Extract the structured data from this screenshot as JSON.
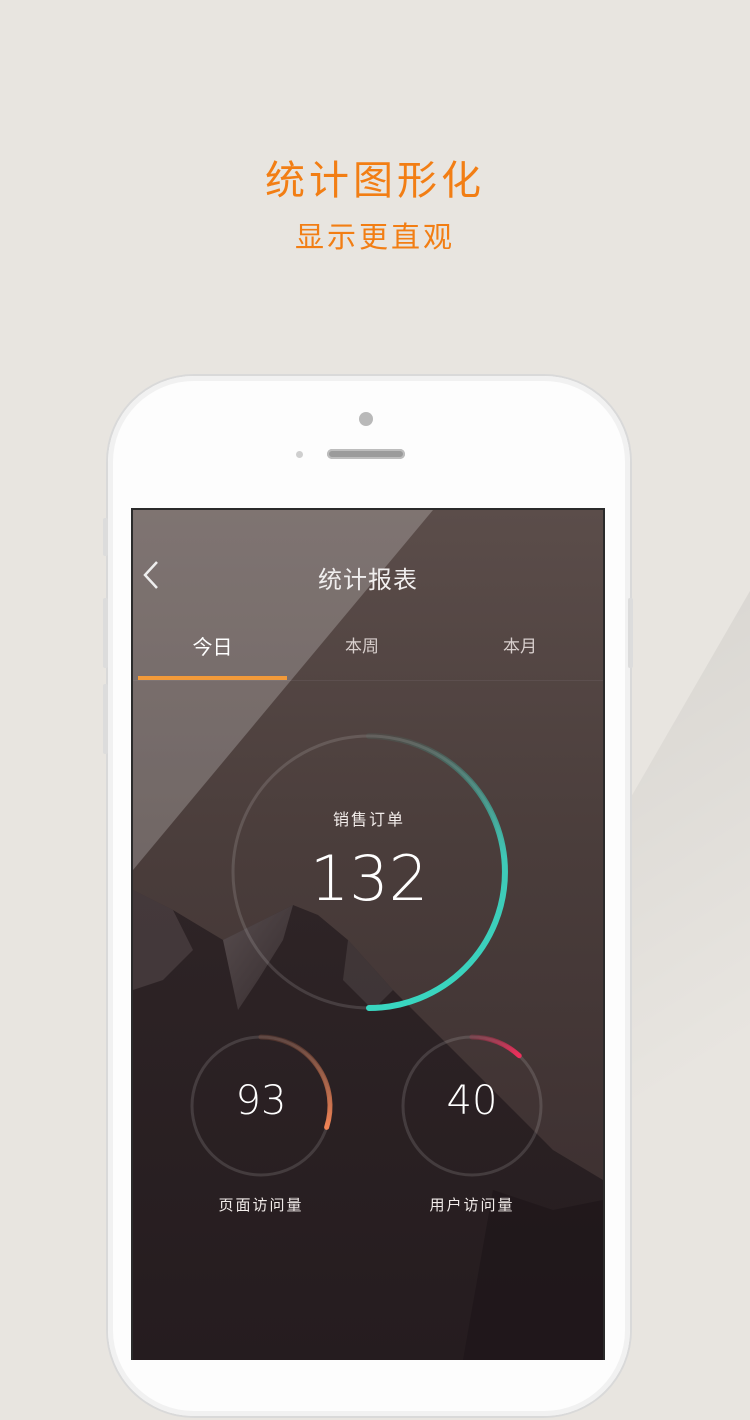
{
  "promo": {
    "title": "统计图形化",
    "subtitle": "显示更直观"
  },
  "colors": {
    "accent": "#f27e14",
    "tab_underline": "#f29a3a",
    "ring_teal": "#39d6c0",
    "ring_orange": "#f08355",
    "ring_pink": "#ef2f5c"
  },
  "screen": {
    "title": "统计报表",
    "back_icon": "chevron-left-icon",
    "tabs": [
      {
        "label": "今日",
        "active": true
      },
      {
        "label": "本周",
        "active": false
      },
      {
        "label": "本月",
        "active": false
      }
    ],
    "stats": {
      "main": {
        "label": "销售订单",
        "value": "132",
        "progress": 0.5
      },
      "left": {
        "label": "页面访问量",
        "value": "93",
        "progress": 0.3
      },
      "right": {
        "label": "用户访问量",
        "value": "40",
        "progress": 0.12
      }
    }
  }
}
